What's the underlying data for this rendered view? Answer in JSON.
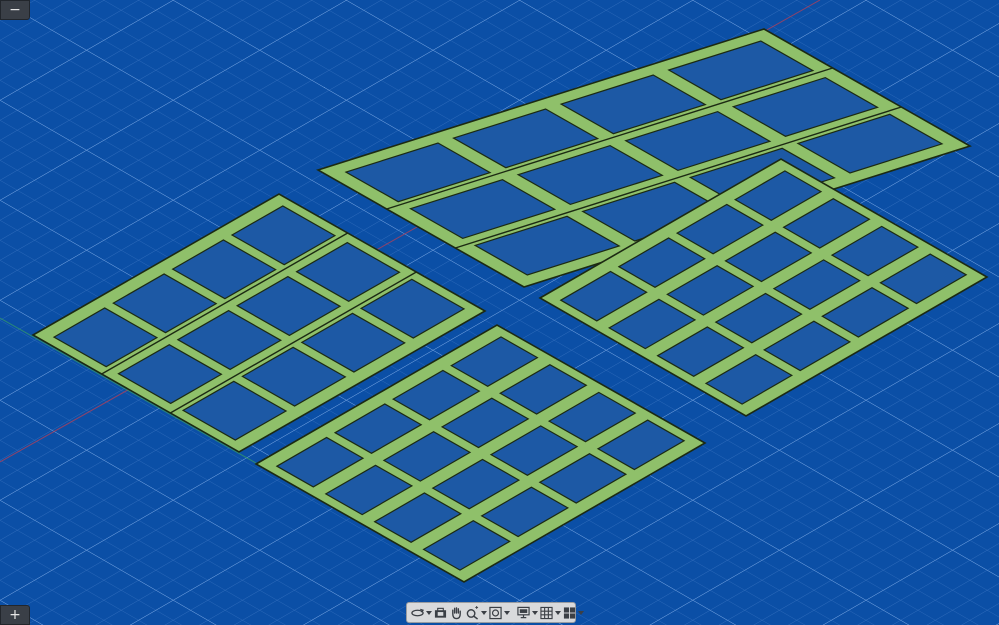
{
  "app": {
    "view": "isometric-3d",
    "background_color": "#0b4fa6",
    "grid_color": "#5f93d6",
    "part_fill_color": "#8fc06a",
    "part_edge_color": "#1c2a12"
  },
  "scene": {
    "panels": [
      {
        "name": "panel-back-top",
        "cols": 4,
        "rows": 3,
        "joined_strips": true
      },
      {
        "name": "panel-left",
        "cols": 4,
        "rows": 3,
        "joined_strips": true
      },
      {
        "name": "panel-front",
        "cols": 4,
        "rows": 4,
        "joined_strips": false
      },
      {
        "name": "panel-right",
        "cols": 4,
        "rows": 4,
        "joined_strips": false
      }
    ]
  },
  "controls": {
    "collapse_symbol": "−",
    "expand_symbol": "+"
  },
  "toolbar": {
    "items": [
      {
        "icon": "orbit-icon",
        "dropdown": true
      },
      {
        "icon": "look-at-icon",
        "dropdown": false
      },
      {
        "icon": "pan-hand-icon",
        "dropdown": false
      },
      {
        "icon": "zoom-icon",
        "dropdown": true
      },
      {
        "icon": "fit-view-icon",
        "dropdown": true
      },
      {
        "icon": "display-settings-icon",
        "dropdown": true
      },
      {
        "icon": "grid-snaps-icon",
        "dropdown": true
      },
      {
        "icon": "viewports-icon",
        "dropdown": true
      }
    ]
  }
}
